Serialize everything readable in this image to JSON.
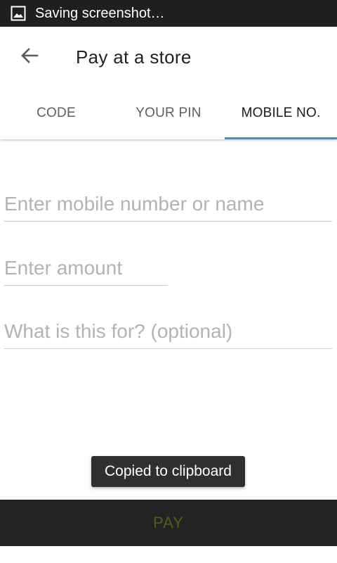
{
  "status_bar": {
    "notification_text": "Saving screenshot…",
    "icon": "image-icon"
  },
  "app_bar": {
    "title": "Pay at a store",
    "back_icon": "arrow-back-icon"
  },
  "tabs": [
    {
      "label": "CODE",
      "active": false
    },
    {
      "label": "YOUR PIN",
      "active": false
    },
    {
      "label": "MOBILE NO.",
      "active": true
    }
  ],
  "form": {
    "mobile_placeholder": "Enter mobile number or name",
    "amount_placeholder": "Enter amount",
    "note_placeholder": "What is this for? (optional)"
  },
  "toast": {
    "text": "Copied to clipboard"
  },
  "pay_button": {
    "label": "PAY"
  },
  "colors": {
    "status_bar": "#1f1f1f",
    "tab_indicator": "#4a86e8",
    "pay_button_bg": "#232323",
    "pay_button_text": "#545b20"
  }
}
